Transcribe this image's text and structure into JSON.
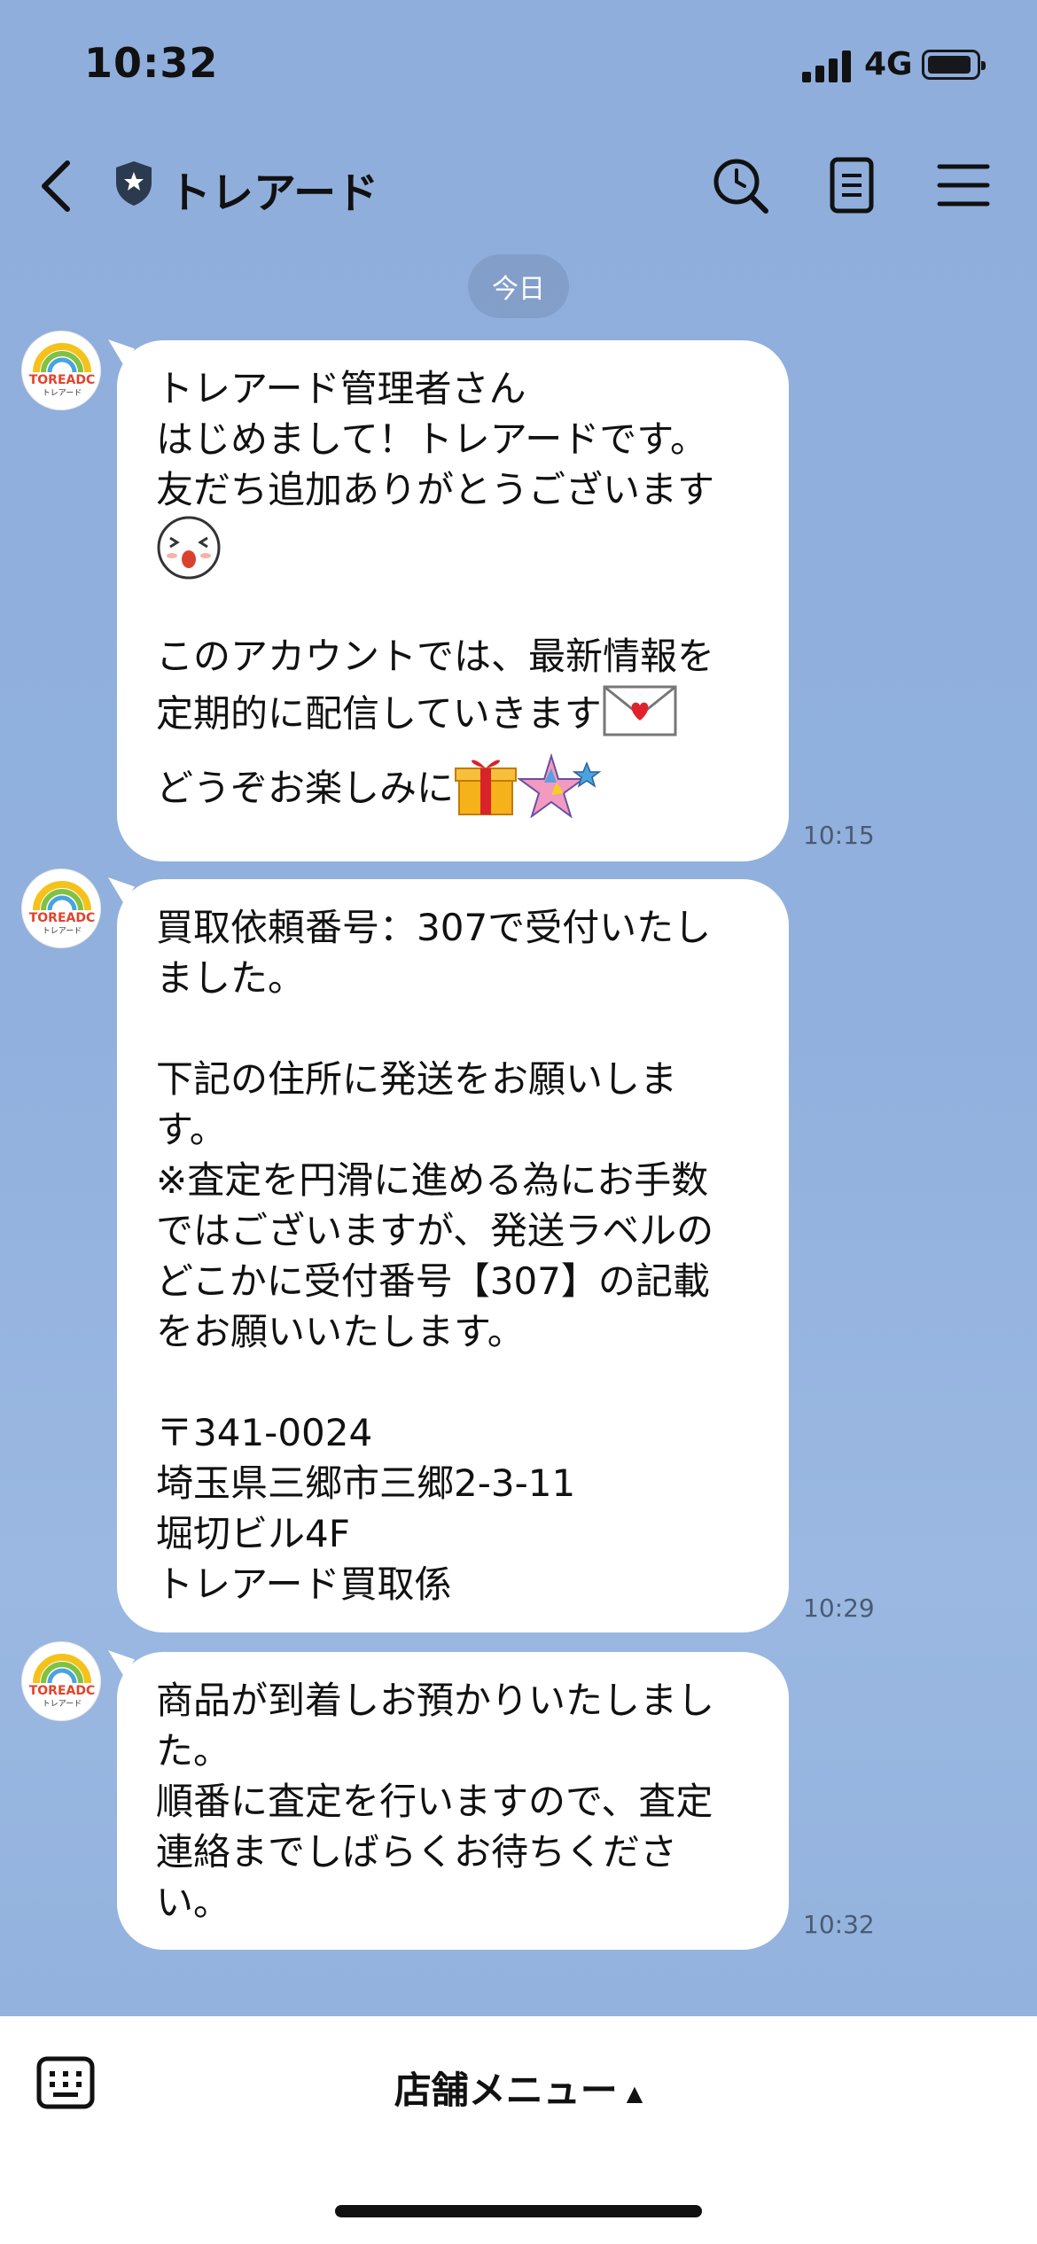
{
  "status_bar": {
    "time": "10:32",
    "network": "4G"
  },
  "header": {
    "back_icon": "chevron-left-icon",
    "official_badge_icon": "shield-star-icon",
    "title": "トレアード",
    "search_icon": "search-clock-icon",
    "notes_icon": "notes-icon",
    "menu_icon": "hamburger-menu-icon"
  },
  "date_separator": "今日",
  "avatar_text": {
    "logo": "TOREADC",
    "sub": "トレアード"
  },
  "messages": [
    {
      "text_1": "トレアード管理者さん\nはじめまして！トレアードです。\n友だち追加ありがとうございます",
      "text_2": "\nこのアカウントでは、最新情報を\n定期的に配信していきます",
      "text_3": "どうぞお楽しみに",
      "time": "10:15"
    },
    {
      "text": "買取依頼番号：307で受付いたし\nました。\n\n下記の住所に発送をお願いしま\nす。\n※査定を円滑に進める為にお手数\nではございますが、発送ラベルの\nどこかに受付番号【307】の記載\nをお願いいたします。\n\n〒341-0024\n埼玉県三郷市三郷2-3-11\n堀切ビル4F\nトレアード買取係",
      "time": "10:29"
    },
    {
      "text": "商品が到着しお預かりいたしまし\nた。\n順番に査定を行いますので、査定\n連絡までしばらくお待ちくださ\nい。",
      "time": "10:32"
    }
  ],
  "bottom_bar": {
    "keyboard_icon": "keyboard-icon",
    "menu_label": "店舗メニュー",
    "menu_arrow": "▲"
  },
  "colors": {
    "background": "#8faedc",
    "bubble": "#ffffff",
    "date_pill": "#7891b9"
  }
}
